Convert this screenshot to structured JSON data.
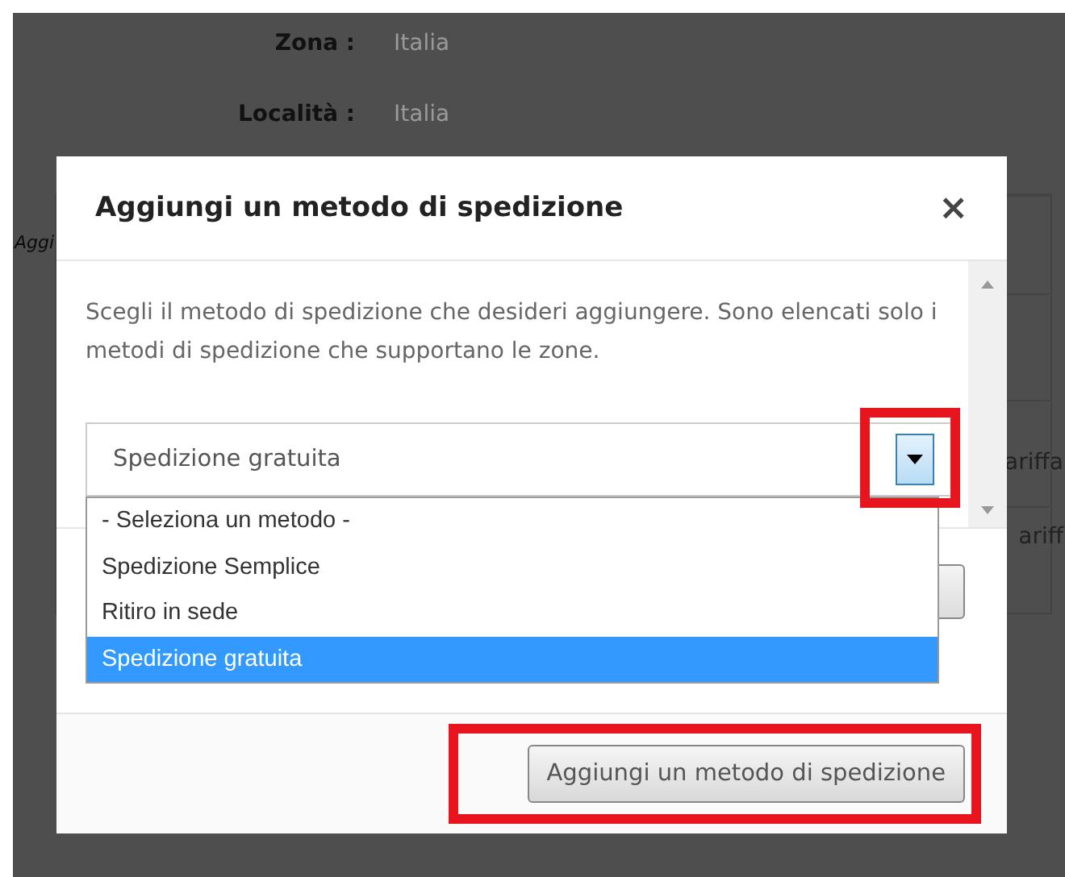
{
  "background": {
    "fields": [
      {
        "label": "Zona :",
        "value": "Italia"
      },
      {
        "label": "Località :",
        "value": "Italia"
      }
    ],
    "left_text": "Aggi",
    "right_texts": [
      "ariffa",
      "ariff"
    ]
  },
  "dialog": {
    "title": "Aggiungi un metodo di spedizione",
    "close": "×",
    "description": "Scegli il metodo di spedizione che desideri aggiungere. Sono elencati solo i metodi di spedizione che supportano le zone.",
    "select": {
      "value": "Spedizione gratuita",
      "expanded": true
    },
    "options": [
      {
        "label": "- Seleziona un metodo -",
        "selected": false
      },
      {
        "label": "Spedizione Semplice",
        "selected": false
      },
      {
        "label": "Ritiro in sede",
        "selected": false
      },
      {
        "label": "Spedizione gratuita",
        "selected": true
      }
    ],
    "submit_button": "Aggiungi un metodo di spedizione"
  }
}
